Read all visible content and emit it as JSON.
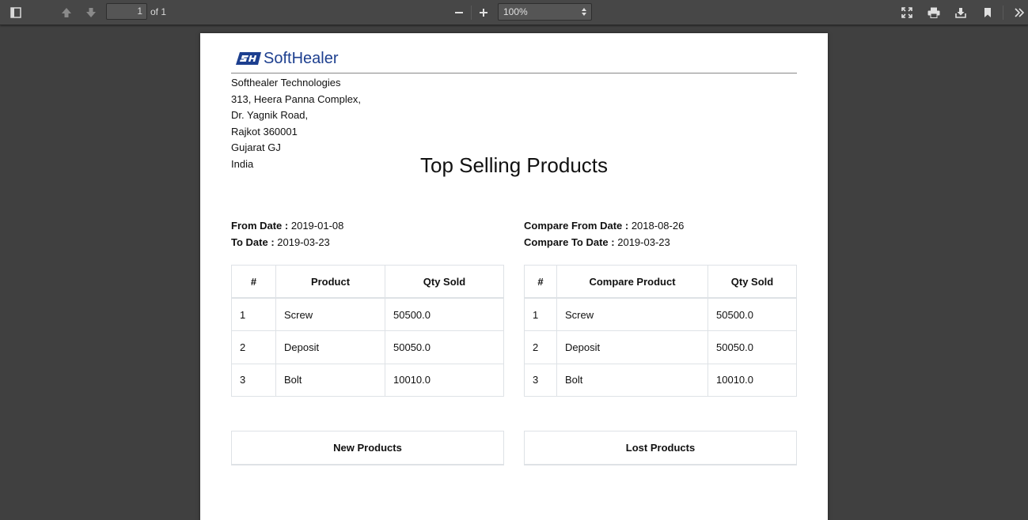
{
  "toolbar": {
    "page_number": "1",
    "page_of": "of 1",
    "zoom": "100%"
  },
  "document": {
    "logo_text": "SoftHealer",
    "address": [
      "Softhealer Technologies",
      "313, Heera Panna Complex,",
      "Dr. Yagnik Road,",
      "Rajkot 360001",
      "Gujarat GJ",
      "India"
    ],
    "title": "Top Selling Products",
    "from_label": "From Date :",
    "from_value": "2019-01-08",
    "to_label": "To Date :",
    "to_value": "2019-03-23",
    "compare_from_label": "Compare From Date :",
    "compare_from_value": "2018-08-26",
    "compare_to_label": "Compare To Date :",
    "compare_to_value": "2019-03-23",
    "left_table": {
      "headers": [
        "#",
        "Product",
        "Qty Sold"
      ],
      "rows": [
        [
          "1",
          "Screw",
          "50500.0"
        ],
        [
          "2",
          "Deposit",
          "50050.0"
        ],
        [
          "3",
          "Bolt",
          "10010.0"
        ]
      ]
    },
    "right_table": {
      "headers": [
        "#",
        "Compare Product",
        "Qty Sold"
      ],
      "rows": [
        [
          "1",
          "Screw",
          "50500.0"
        ],
        [
          "2",
          "Deposit",
          "50050.0"
        ],
        [
          "3",
          "Bolt",
          "10010.0"
        ]
      ]
    },
    "new_products_label": "New Products",
    "lost_products_label": "Lost Products"
  }
}
